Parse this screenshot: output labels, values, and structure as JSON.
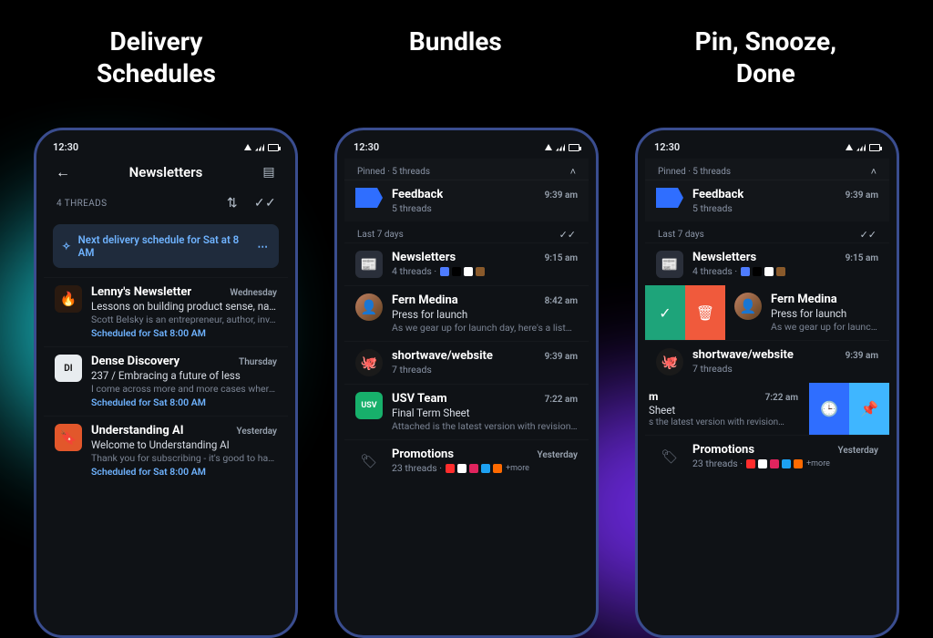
{
  "titles": {
    "left": "Delivery\nSchedules",
    "center": "Bundles",
    "right": "Pin, Snooze,\nDone"
  },
  "statusbar": {
    "time": "12:30"
  },
  "phone1": {
    "appbar_title": "Newsletters",
    "threads_count": "4 THREADS",
    "banner": "Next delivery schedule for Sat at 8 AM",
    "items": [
      {
        "icon": "🔥",
        "from": "Lenny's Newsletter",
        "time": "Wednesday",
        "subject": "Lessons on building product sense, navigat…",
        "preview": "Scott Belsky is an entrepreneur, author, inv…",
        "sched": "Scheduled for Sat 8:00 AM"
      },
      {
        "icon_text": "DI",
        "icon_bg": "#e8ecef",
        "icon_fg": "#1a1a1a",
        "from": "Dense Discovery",
        "time": "Thursday",
        "subject": "237 / Embracing a future of less",
        "preview": "I come across more and more cases where…",
        "sched": "Scheduled for Sat 8:00 AM"
      },
      {
        "icon": "🔖",
        "icon_bg": "#e2572b",
        "from": "Understanding AI",
        "time": "Yesterday",
        "subject": "Welcome to Understanding AI",
        "preview": "Thank you for subscribing - it's good to hav…",
        "sched": "Scheduled for Sat 8:00 AM"
      }
    ]
  },
  "phone2": {
    "pinned_label": "Pinned · 5 threads",
    "pinned": {
      "from": "Feedback",
      "sub": "5 threads",
      "time": "9:39 am"
    },
    "section2": "Last 7 days",
    "items": [
      {
        "type": "bundle",
        "icon": "📰",
        "from": "Newsletters",
        "sub": "4 threads ·",
        "time": "9:15 am",
        "chips": [
          "#4e7cff",
          "#000000",
          "#ffffff",
          "#8a5a2b"
        ]
      },
      {
        "type": "thread",
        "avatar_img": true,
        "from": "Fern Medina",
        "subject": "Press for launch",
        "preview": "As we gear up for launch day, here's a list…",
        "time": "8:42 am"
      },
      {
        "type": "bundle",
        "icon": "🐙",
        "icon_bg": "#1a1a1a",
        "round": true,
        "from": "shortwave/website",
        "sub": "7 threads",
        "time": "9:39 am"
      },
      {
        "type": "thread",
        "icon_text": "USV",
        "icon_bg": "#17b06b",
        "from": "USV Team",
        "subject": "Final Term Sheet",
        "preview": "Attached is the latest version with revision…",
        "time": "7:22 am"
      },
      {
        "type": "bundle",
        "icon": "🏷",
        "tag": true,
        "from": "Promotions",
        "sub": "23 threads ·",
        "more": "+more",
        "time": "Yesterday",
        "chips": [
          "#ff2d2d",
          "#ffffff",
          "#e0245e",
          "#1da1f2",
          "#ff6a00"
        ]
      }
    ]
  },
  "phone3": {
    "pinned_label": "Pinned · 5 threads",
    "pinned": {
      "from": "Feedback",
      "sub": "5 threads",
      "time": "9:39 am"
    },
    "section2": "Last 7 days",
    "newsletters": {
      "from": "Newsletters",
      "sub": "4 threads ·",
      "time": "9:15 am",
      "chips": [
        "#4e7cff",
        "#000000",
        "#ffffff",
        "#8a5a2b"
      ]
    },
    "swipe_item": {
      "from": "Fern Medina",
      "subject": "Press for launch",
      "preview": "As we gear up for launch d"
    },
    "website": {
      "from": "shortwave/website",
      "sub": "7 threads",
      "time": "9:39 am"
    },
    "usv": {
      "from_suffix": "m",
      "subject": "Sheet",
      "preview": "s the latest version with revision…",
      "time": "7:22 am"
    },
    "promotions": {
      "from": "Promotions",
      "sub": "23 threads ·",
      "more": "+more",
      "time": "Yesterday",
      "chips": [
        "#ff2d2d",
        "#ffffff",
        "#e0245e",
        "#1da1f2",
        "#ff6a00"
      ]
    }
  }
}
